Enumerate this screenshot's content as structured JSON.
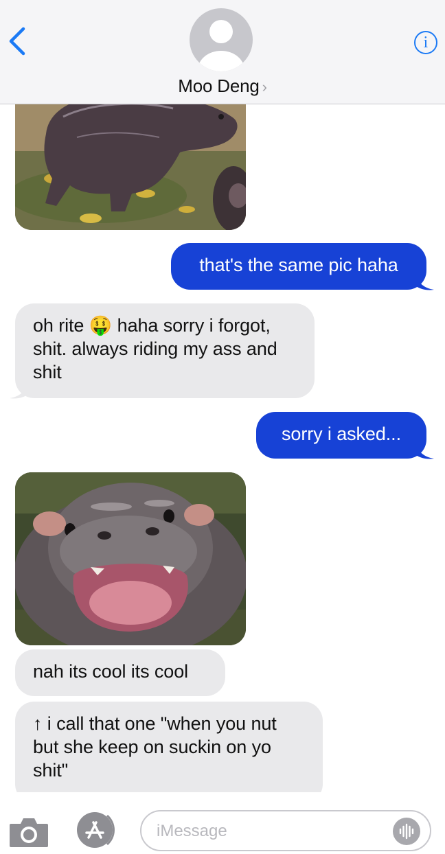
{
  "header": {
    "contact_name": "Moo Deng",
    "chevron": "›",
    "info_glyph": "i"
  },
  "messages": [
    {
      "type": "image",
      "direction": "incoming",
      "description_icon": "pygmy-hippo-running-photo"
    },
    {
      "type": "text",
      "direction": "outgoing",
      "text": "that's the same pic haha"
    },
    {
      "type": "text",
      "direction": "incoming",
      "text": "oh rite 🤑 haha sorry i forgot,\nshit. always riding my ass and\nshit"
    },
    {
      "type": "text",
      "direction": "outgoing",
      "text": "sorry i asked..."
    },
    {
      "type": "image",
      "direction": "incoming",
      "description_icon": "pygmy-hippo-open-mouth-photo"
    },
    {
      "type": "text",
      "direction": "incoming",
      "text": "nah its cool its cool"
    },
    {
      "type": "text",
      "direction": "incoming",
      "text": "↑ i call that one \"when you nut\nbut she keep on suckin on yo\nshit\""
    }
  ],
  "input_bar": {
    "placeholder": "iMessage",
    "icons": [
      "camera-icon",
      "app-store-icon",
      "audio-waveform-icon"
    ]
  },
  "colors": {
    "outgoing_bubble": "#1742d6",
    "incoming_bubble": "#e9e9eb",
    "accent": "#1b7af5"
  }
}
